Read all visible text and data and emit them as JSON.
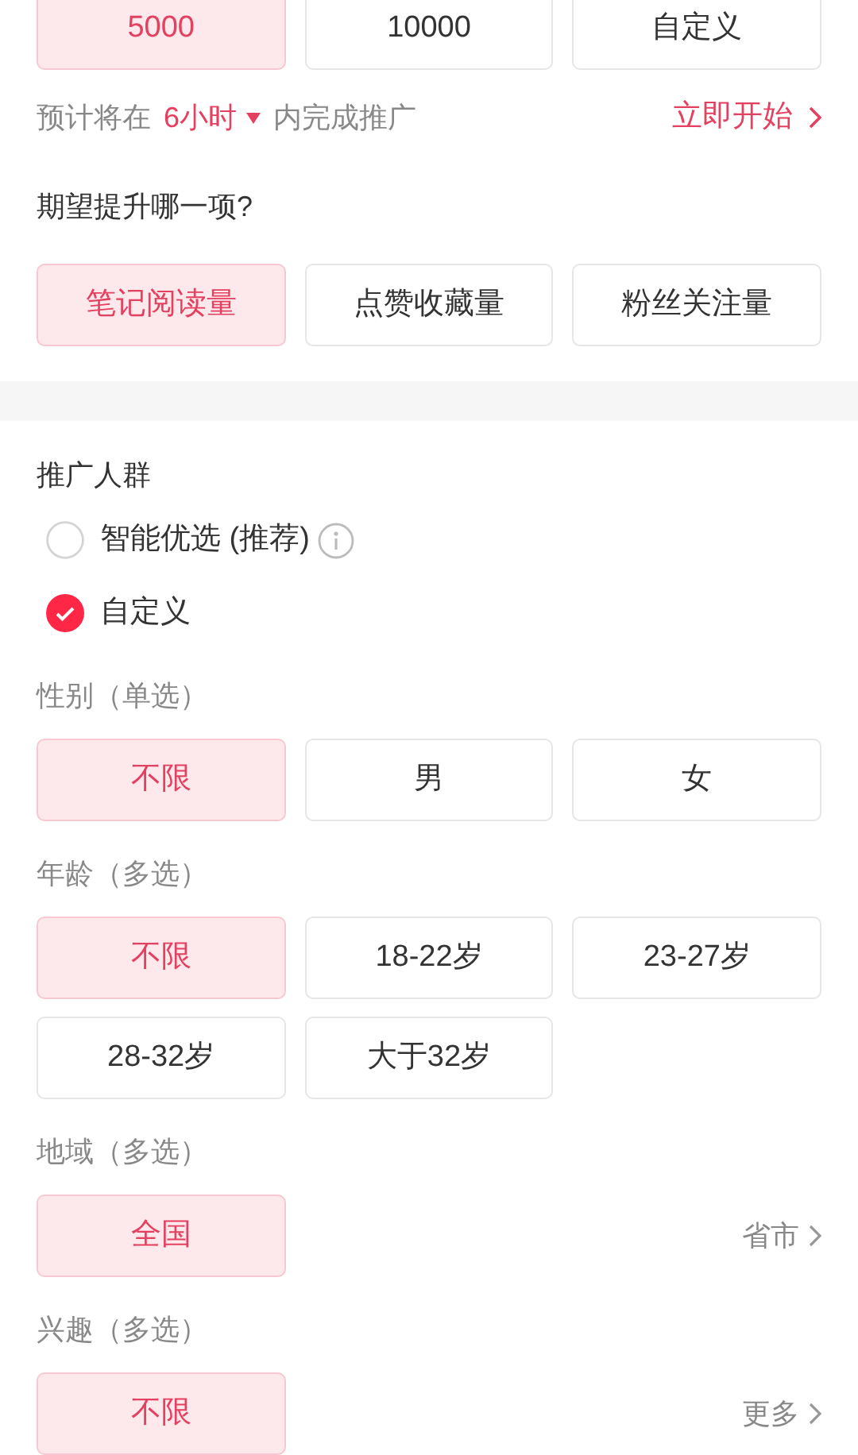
{
  "budget": {
    "options": [
      {
        "label": "5000",
        "selected": true
      },
      {
        "label": "10000",
        "selected": false
      },
      {
        "label": "自定义",
        "selected": false
      }
    ],
    "estimate": {
      "prefix": "预计将在",
      "duration": "6小时",
      "suffix": "内完成推广"
    },
    "start_link": "立即开始"
  },
  "goal": {
    "title": "期望提升哪一项?",
    "options": [
      {
        "label": "笔记阅读量",
        "selected": true
      },
      {
        "label": "点赞收藏量",
        "selected": false
      },
      {
        "label": "粉丝关注量",
        "selected": false
      }
    ]
  },
  "audience": {
    "title": "推广人群",
    "modes": [
      {
        "label": "智能优选 (推荐)",
        "selected": false,
        "info": true
      },
      {
        "label": "自定义",
        "selected": true,
        "info": false
      }
    ],
    "groups": [
      {
        "title": "性别（单选）",
        "options": [
          {
            "label": "不限",
            "selected": true
          },
          {
            "label": "男",
            "selected": false
          },
          {
            "label": "女",
            "selected": false
          }
        ]
      },
      {
        "title": "年龄（多选）",
        "options": [
          {
            "label": "不限",
            "selected": true
          },
          {
            "label": "18-22岁",
            "selected": false
          },
          {
            "label": "23-27岁",
            "selected": false
          },
          {
            "label": "28-32岁",
            "selected": false
          },
          {
            "label": "大于32岁",
            "selected": false
          }
        ]
      },
      {
        "title": "地域（多选）",
        "options": [
          {
            "label": "全国",
            "selected": true
          }
        ],
        "more_link": "省市"
      },
      {
        "title": "兴趣（多选）",
        "options": [
          {
            "label": "不限",
            "selected": true
          }
        ],
        "more_link": "更多"
      }
    ]
  }
}
